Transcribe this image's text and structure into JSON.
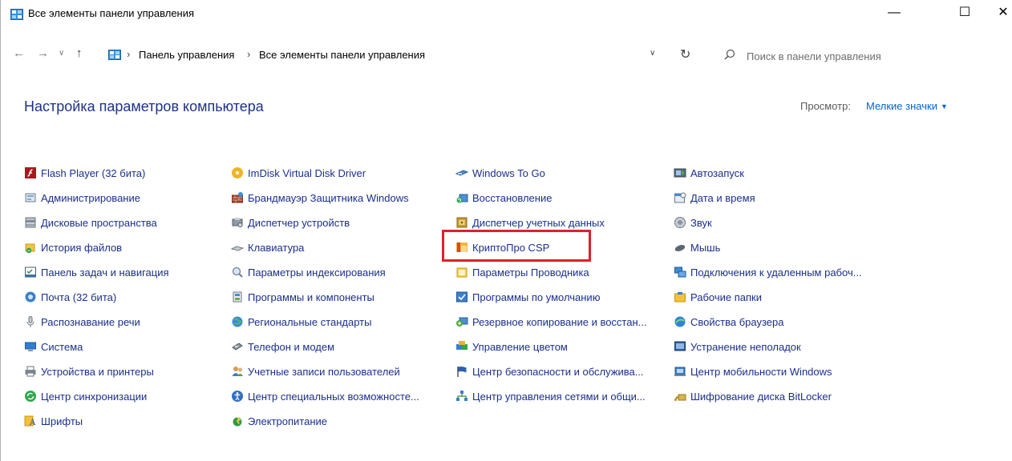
{
  "window": {
    "title": "Все элементы панели управления",
    "minimize": "—",
    "maximize": "☐",
    "close": "✕"
  },
  "navigation": {
    "back": "←",
    "forward": "→",
    "recent": "∨",
    "up": "↑",
    "separator": "›",
    "dropdown": "∨",
    "refresh": "↻",
    "breadcrumbs": [
      "Панель управления",
      "Все элементы панели управления"
    ]
  },
  "search": {
    "placeholder": "Поиск в панели управления"
  },
  "header": {
    "title": "Настройка параметров компьютера",
    "view_label": "Просмотр:",
    "view_value": "Мелкие значки",
    "view_caret": "▼"
  },
  "columns": [
    {
      "items": [
        {
          "label": "Flash Player (32 бита)",
          "icon": "flash-icon"
        },
        {
          "label": "Администрирование",
          "icon": "admin-tools-icon"
        },
        {
          "label": "Дисковые пространства",
          "icon": "storage-spaces-icon"
        },
        {
          "label": "История файлов",
          "icon": "file-history-icon"
        },
        {
          "label": "Панель задач и навигация",
          "icon": "taskbar-icon"
        },
        {
          "label": "Почта (32 бита)",
          "icon": "mail-icon"
        },
        {
          "label": "Распознавание речи",
          "icon": "microphone-icon"
        },
        {
          "label": "Система",
          "icon": "system-icon"
        },
        {
          "label": "Устройства и принтеры",
          "icon": "printer-icon"
        },
        {
          "label": "Центр синхронизации",
          "icon": "sync-icon"
        },
        {
          "label": "Шрифты",
          "icon": "fonts-icon"
        }
      ]
    },
    {
      "items": [
        {
          "label": "ImDisk Virtual Disk Driver",
          "icon": "imdisk-icon"
        },
        {
          "label": "Брандмауэр Защитника Windows",
          "icon": "firewall-icon"
        },
        {
          "label": "Диспетчер устройств",
          "icon": "device-manager-icon"
        },
        {
          "label": "Клавиатура",
          "icon": "keyboard-icon"
        },
        {
          "label": "Параметры индексирования",
          "icon": "indexing-icon"
        },
        {
          "label": "Программы и компоненты",
          "icon": "programs-icon"
        },
        {
          "label": "Региональные стандарты",
          "icon": "region-icon"
        },
        {
          "label": "Телефон и модем",
          "icon": "phone-modem-icon"
        },
        {
          "label": "Учетные записи пользователей",
          "icon": "user-accounts-icon"
        },
        {
          "label": "Центр специальных возможносте...",
          "icon": "accessibility-icon"
        },
        {
          "label": "Электропитание",
          "icon": "power-icon"
        }
      ]
    },
    {
      "items": [
        {
          "label": "Windows To Go",
          "icon": "windows-to-go-icon"
        },
        {
          "label": "Восстановление",
          "icon": "recovery-icon"
        },
        {
          "label": "Диспетчер учетных данных",
          "icon": "credential-manager-icon"
        },
        {
          "label": "КриптоПро CSP",
          "icon": "cryptopro-icon"
        },
        {
          "label": "Параметры Проводника",
          "icon": "explorer-options-icon"
        },
        {
          "label": "Программы по умолчанию",
          "icon": "default-programs-icon"
        },
        {
          "label": "Резервное копирование и восстан...",
          "icon": "backup-icon"
        },
        {
          "label": "Управление цветом",
          "icon": "color-management-icon"
        },
        {
          "label": "Центр безопасности и обслужива...",
          "icon": "security-flag-icon"
        },
        {
          "label": "Центр управления сетями и общи...",
          "icon": "network-icon"
        }
      ]
    },
    {
      "items": [
        {
          "label": "Автозапуск",
          "icon": "autoplay-icon"
        },
        {
          "label": "Дата и время",
          "icon": "date-time-icon"
        },
        {
          "label": "Звук",
          "icon": "sound-icon"
        },
        {
          "label": "Мышь",
          "icon": "mouse-icon"
        },
        {
          "label": "Подключения к удаленным рабоч...",
          "icon": "remote-desktop-icon"
        },
        {
          "label": "Рабочие папки",
          "icon": "work-folders-icon"
        },
        {
          "label": "Свойства браузера",
          "icon": "internet-options-icon"
        },
        {
          "label": "Устранение неполадок",
          "icon": "troubleshooting-icon"
        },
        {
          "label": "Центр мобильности Windows",
          "icon": "mobility-center-icon"
        },
        {
          "label": "Шифрование диска BitLocker",
          "icon": "bitlocker-icon"
        }
      ]
    }
  ],
  "colors": {
    "title_blue": "#1e3287",
    "link_blue": "#1a2f8a",
    "view_link": "#0066cc",
    "highlight_red": "#e0202a"
  }
}
